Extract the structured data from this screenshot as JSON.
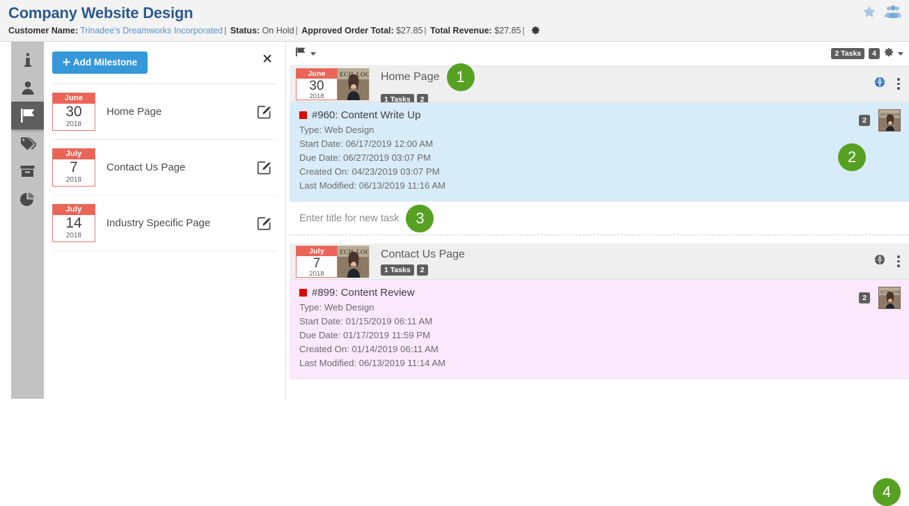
{
  "header": {
    "title": "Company Website Design",
    "meta": {
      "customer_label": "Customer Name:",
      "customer_value": "Trinadee's Dreamworks Incorporated",
      "status_label": "Status:",
      "status_value": "On Hold",
      "approved_label": "Approved Order Total:",
      "approved_value": "$27.85",
      "revenue_label": "Total Revenue:",
      "revenue_value": "$27.85",
      "separator": "|"
    },
    "icons": {
      "favorite": "star-icon",
      "team": "people-group-icon",
      "settings": "gear-icon"
    }
  },
  "iconbar": {
    "items": [
      {
        "name": "info-icon",
        "active": false
      },
      {
        "name": "contact-person-icon",
        "active": false
      },
      {
        "name": "flag-milestones-icon",
        "active": true
      },
      {
        "name": "tags-icon",
        "active": false
      },
      {
        "name": "archive-box-icon",
        "active": false
      },
      {
        "name": "pie-chart-reports-icon",
        "active": false
      }
    ]
  },
  "milestone_panel": {
    "add_button": "Add Milestone",
    "add_button_plus": "✛",
    "close_label": "✕",
    "items": [
      {
        "month": "June",
        "day": "30",
        "year": "2018",
        "name": "Home Page"
      },
      {
        "month": "July",
        "day": "7",
        "year": "2018",
        "name": "Contact Us Page"
      },
      {
        "month": "July",
        "day": "14",
        "year": "2018",
        "name": "Industry Specific Page"
      }
    ]
  },
  "main": {
    "toolbar": {
      "flag_icon": "flag-icon",
      "tasks_badge": "2 Tasks",
      "count_badge": "4",
      "gear_icon": "gear-icon"
    },
    "new_task_placeholder": "Enter title for new task",
    "groups": [
      {
        "month": "June",
        "day": "30",
        "year": "2018",
        "title": "Home Page",
        "tasks_badge": "1 Tasks",
        "count_badge": "2",
        "globe_icon": "globe-icon",
        "menu_icon": "kebab-menu-icon",
        "task": {
          "title": "#960: Content Write Up",
          "type": "Type: Web Design",
          "start_date": "Start Date: 06/17/2019 12:00 AM",
          "due_date": "Due Date: 06/27/2019 03:07 PM",
          "created_on": "Created On: 04/23/2019 03:07 PM",
          "last_modified": "Last Modified: 06/13/2019 11:16 AM",
          "attachment_badge": "2"
        }
      },
      {
        "month": "July",
        "day": "7",
        "year": "2018",
        "title": "Contact Us Page",
        "tasks_badge": "1 Tasks",
        "count_badge": "2",
        "globe_icon": "globe-icon",
        "menu_icon": "kebab-menu-icon",
        "task": {
          "title": "#899: Content Review",
          "type": "Type: Web Design",
          "start_date": "Start Date: 01/15/2019 06:11 AM",
          "due_date": "Due Date: 01/17/2019 11:59 PM",
          "created_on": "Created On: 01/14/2019 06:11 AM",
          "last_modified": "Last Modified: 06/13/2019 11:14 AM",
          "attachment_badge": "2"
        }
      }
    ]
  },
  "markers": {
    "one": "1",
    "two": "2",
    "three": "3",
    "four": "4"
  },
  "colors": {
    "title_blue": "#2b5a8e",
    "accent_blue": "#3498db",
    "calendar_red": "#ea6557",
    "marker_green": "#56a022",
    "task_blue_bg": "#d8ebf8",
    "task_pink_bg": "#fbe8fd",
    "iconbar_grey": "#c2c2c2",
    "priority_red": "#d90000"
  }
}
